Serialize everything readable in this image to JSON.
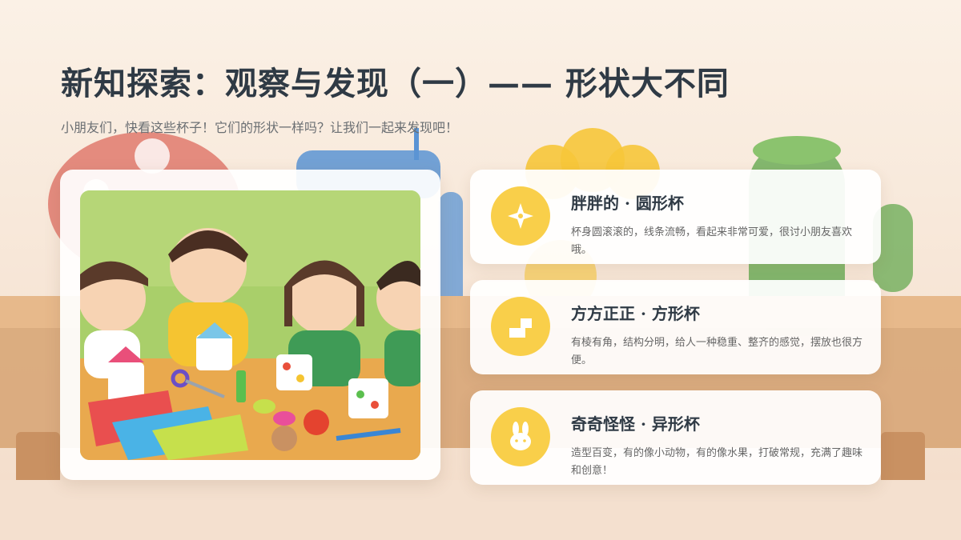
{
  "page": {
    "title": "新知探索：观察与发现（一）—— 形状大不同",
    "subtitle": "小朋友们，快看这些杯子！它们的形状一样吗？让我们一起来发现吧！"
  },
  "colors": {
    "accent": "#f9cf4a",
    "title": "#2f3a45",
    "background": "#f6e9dc"
  },
  "image": {
    "description_icon": "children-crafting-cups-photo"
  },
  "cards": [
    {
      "title": "胖胖的 · 圆形杯",
      "desc": "杯身圆滚滚的，线条流畅，看起来非常可爱，很讨小朋友喜欢哦。",
      "icon": "sparkle-icon"
    },
    {
      "title": "方方正正 · 方形杯",
      "desc": "有棱有角，结构分明，给人一种稳重、整齐的感觉，摆放也很方便。",
      "icon": "square-steps-icon"
    },
    {
      "title": "奇奇怪怪 · 异形杯",
      "desc": "造型百变，有的像小动物，有的像水果，打破常规，充满了趣味和创意！",
      "icon": "bunny-icon"
    }
  ]
}
